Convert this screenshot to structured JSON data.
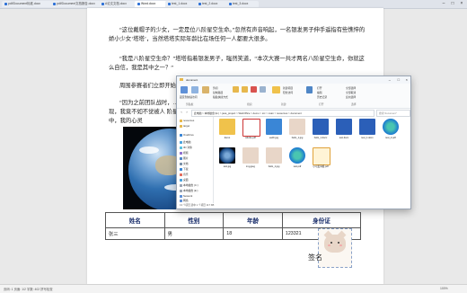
{
  "browser_tabs": [
    {
      "label": "pdf/Document标准.docx",
      "active": false
    },
    {
      "label": "pdf/Document文档报告.docx",
      "active": false
    },
    {
      "label": "A论文文档.docx",
      "active": false
    },
    {
      "label": "Word.docx",
      "active": true
    },
    {
      "label": "test_1.docx",
      "active": false
    },
    {
      "label": "test_2.docx",
      "active": false
    },
    {
      "label": "test_3.docx",
      "active": false
    }
  ],
  "document": {
    "paragraphs": [
      "“这位戴帽子的少女，一定是位八阶星空生命。”忽然有声音响起，一名银发男子伸手遥指有些憔悴的娇小少女‘塔塔’，当然塔塔实际年龄比在场任何一人都要大很多。",
      "“我是八阶星空生命？”塔塔指着银发男子，嗤然笑道，“本次大赛一共才两名八阶星空生命，你就这么自信，我是其中之一？”",
      "周围参赛者们立即开始",
      "“因为之前团队战时，… 我发现，我竟不如不觉被人 阶星空生命中，我的心灵"
    ],
    "table": {
      "headers": [
        "姓名",
        "性别",
        "年龄",
        "身份证"
      ],
      "rows": [
        [
          "张三",
          "男",
          "18",
          "123321"
        ]
      ]
    },
    "signature_label": "签名"
  },
  "explorer": {
    "title": "document",
    "ribbon": {
      "groups": [
        "剪贴板",
        "组织",
        "新建",
        "打开",
        "选择"
      ],
      "buttons": [
        "固定到快速访问",
        "复制",
        "粘贴",
        "剪切",
        "复制路径",
        "粘贴快捷方式",
        "移动到",
        "复制到",
        "删除",
        "重命名",
        "新建文件夹",
        "新建项目",
        "轻松访问",
        "属性",
        "打开",
        "编辑",
        "历史记录",
        "全部选择",
        "全部取消",
        "反向选择"
      ]
    },
    "address": "此电脑 > 本地磁盘 (E:) > java_project > WebOffice > demo > src > main > resources > document",
    "search_placeholder": "搜索\"document\"",
    "sidebar": [
      "resources",
      "target",
      "OneDrive",
      "此电脑",
      "3D 对象",
      "视频",
      "图片",
      "文档",
      "下载",
      "音乐",
      "桌面",
      "本地磁盘 (C:)",
      "本地磁盘 (E:)",
      "Network",
      "网络"
    ],
    "files": [
      {
        "name": "demo",
        "kind": "folder"
      },
      {
        "name": "Adobe.pdf",
        "kind": "pdf"
      },
      {
        "name": "earth.jpg",
        "kind": "image"
      },
      {
        "name": "hello_1.jpg",
        "kind": "cat"
      },
      {
        "name": "hello_1.docx",
        "kind": "word"
      },
      {
        "name": "test.docx",
        "kind": "word"
      },
      {
        "name": "test_1.docx",
        "kind": "word"
      },
      {
        "name": "test_2.pdf",
        "kind": "edge"
      },
      {
        "name": "test.jpg",
        "kind": "earth"
      },
      {
        "name": "img.jpeg",
        "kind": "cat"
      },
      {
        "name": "hello_1.jpg",
        "kind": "cat"
      },
      {
        "name": "test.pdf",
        "kind": "edge"
      },
      {
        "name": "小可爱海报.pdf",
        "kind": "poster"
      }
    ],
    "status": "13 个项目   选中 1 个项目 117 KB"
  },
  "statusbar": {
    "left": "页码: 1  页面: 1/2  字数: 402  拼写检查",
    "right": "100%"
  },
  "colors": {
    "accent": "#2b6fd6",
    "table_header": "#1a2e6b"
  }
}
